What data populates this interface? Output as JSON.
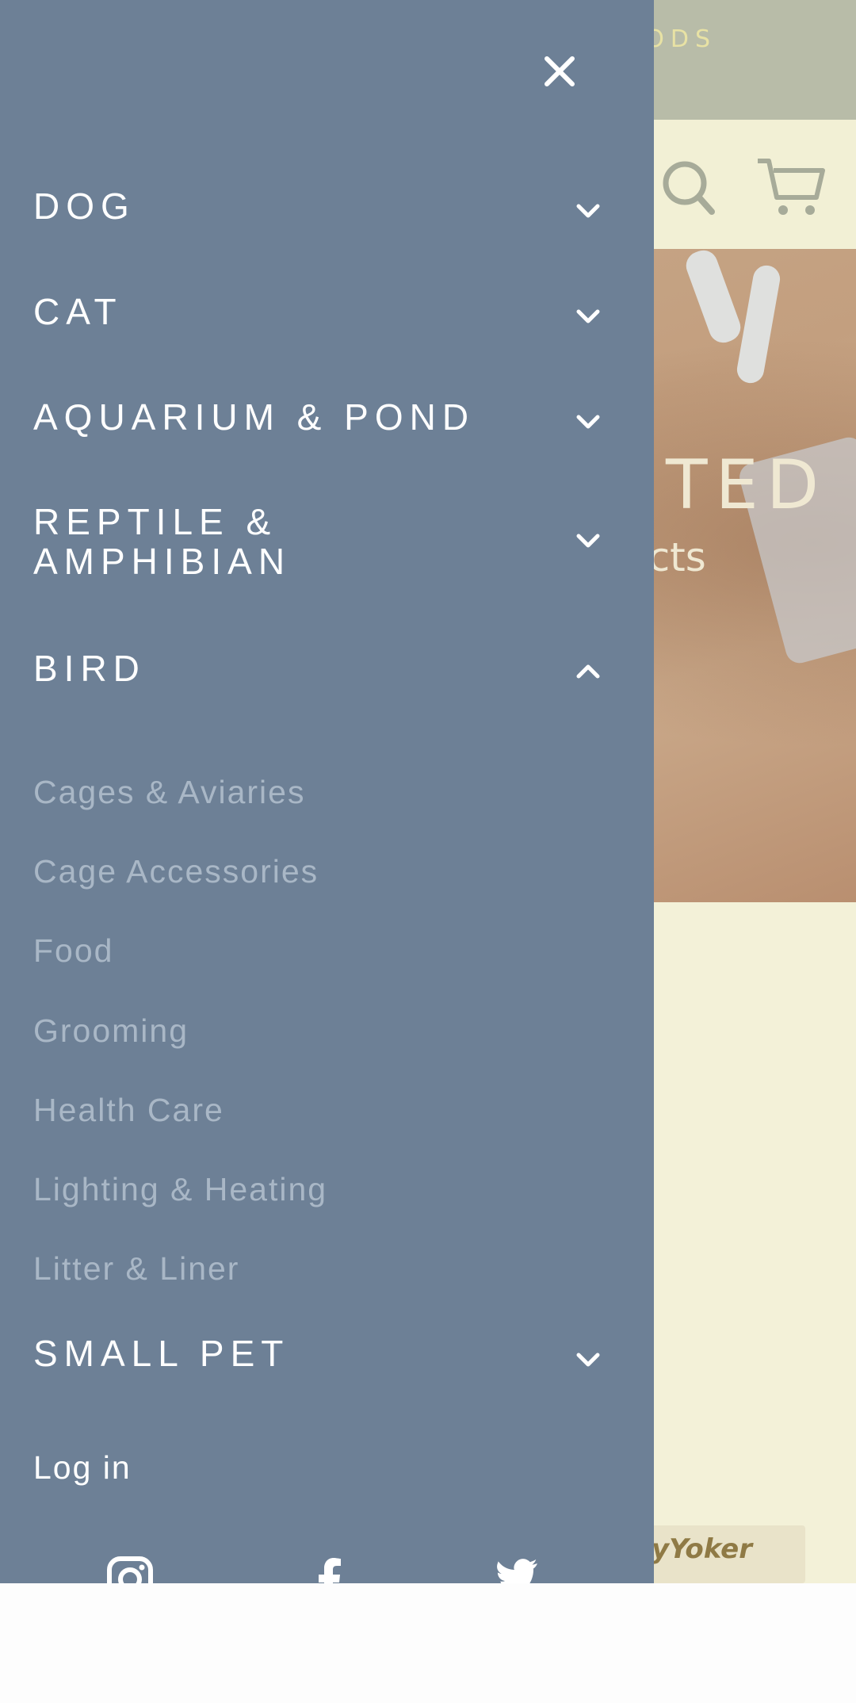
{
  "background_page": {
    "announcement_fragment": "ODS",
    "hero_title_fragment": "TED",
    "hero_subtitle_fragment": "ucts",
    "promo_fragment": "yYoker",
    "header_icons": [
      "search-icon",
      "cart-icon"
    ]
  },
  "drawer": {
    "close_icon": "close-icon",
    "menu": [
      {
        "label": "DOG",
        "expanded": false
      },
      {
        "label": "CAT",
        "expanded": false
      },
      {
        "label": "AQUARIUM & POND",
        "expanded": false
      },
      {
        "label": "REPTILE & AMPHIBIAN",
        "label_line1": "REPTILE &",
        "label_line2": "AMPHIBIAN",
        "expanded": false
      },
      {
        "label": "BIRD",
        "expanded": true
      },
      {
        "label": "SMALL PET",
        "expanded": false
      }
    ],
    "bird_submenu": [
      "Cages & Aviaries",
      "Cage Accessories",
      "Food",
      "Grooming",
      "Health Care",
      "Lighting & Heating",
      "Litter & Liner"
    ],
    "login_label": "Log in",
    "social_icons": [
      "instagram-icon",
      "facebook-icon",
      "twitter-icon"
    ]
  },
  "colors": {
    "drawer_bg": "#6d8096",
    "submenu_text": "#a9b7c6",
    "page_bg": "#f3f1d8"
  }
}
